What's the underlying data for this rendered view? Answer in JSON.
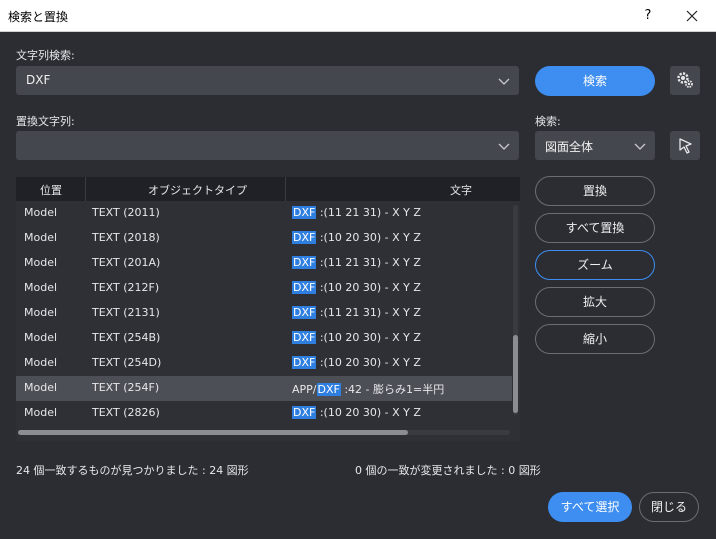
{
  "window": {
    "title": "検索と置換",
    "help_label": "?"
  },
  "find": {
    "label": "文字列検索:",
    "value": "DXF",
    "search_button": "検索"
  },
  "replace": {
    "label": "置換文字列:",
    "value": ""
  },
  "scope": {
    "label": "検索:",
    "value": "図面全体"
  },
  "table": {
    "headers": [
      "位置",
      "オブジェクトタイプ",
      "文字"
    ],
    "rows": [
      {
        "location": "Model",
        "type": "TEXT (2011)",
        "pre": "",
        "match": "DXF",
        "post": " :(11 21 31) - X Y Z"
      },
      {
        "location": "Model",
        "type": "TEXT (2018)",
        "pre": "",
        "match": "DXF",
        "post": " :(10 20 30) - X Y Z"
      },
      {
        "location": "Model",
        "type": "TEXT (201A)",
        "pre": "",
        "match": "DXF",
        "post": " :(11 21 31) - X Y Z"
      },
      {
        "location": "Model",
        "type": "TEXT (212F)",
        "pre": "",
        "match": "DXF",
        "post": " :(10 20 30) - X Y Z"
      },
      {
        "location": "Model",
        "type": "TEXT (2131)",
        "pre": "",
        "match": "DXF",
        "post": " :(11 21 31) - X Y Z"
      },
      {
        "location": "Model",
        "type": "TEXT (254B)",
        "pre": "",
        "match": "DXF",
        "post": " :(10 20 30) - X Y Z"
      },
      {
        "location": "Model",
        "type": "TEXT (254D)",
        "pre": "",
        "match": "DXF",
        "post": " :(10 20 30) - X Y Z"
      },
      {
        "location": "Model",
        "type": "TEXT (254F)",
        "pre": "APP/",
        "match": "DXF",
        "post": " :42 - 膨らみ1=半円"
      },
      {
        "location": "Model",
        "type": "TEXT (2826)",
        "pre": "",
        "match": "DXF",
        "post": " :(10 20 30) - X Y Z"
      }
    ],
    "selected_index": 7
  },
  "actions": {
    "replace": "置換",
    "replace_all": "すべて置換",
    "zoom": "ズーム",
    "zoom_in": "拡大",
    "zoom_out": "縮小"
  },
  "status": {
    "found": "24 個一致するものが見つかりました : 24 図形",
    "changed": "0 個の一致が変更されました : 0 図形"
  },
  "footer": {
    "select_all": "すべて選択",
    "close": "閉じる"
  },
  "colors": {
    "accent": "#3d8ef0",
    "background": "#2b2d33",
    "highlight": "#2f7fe0"
  }
}
